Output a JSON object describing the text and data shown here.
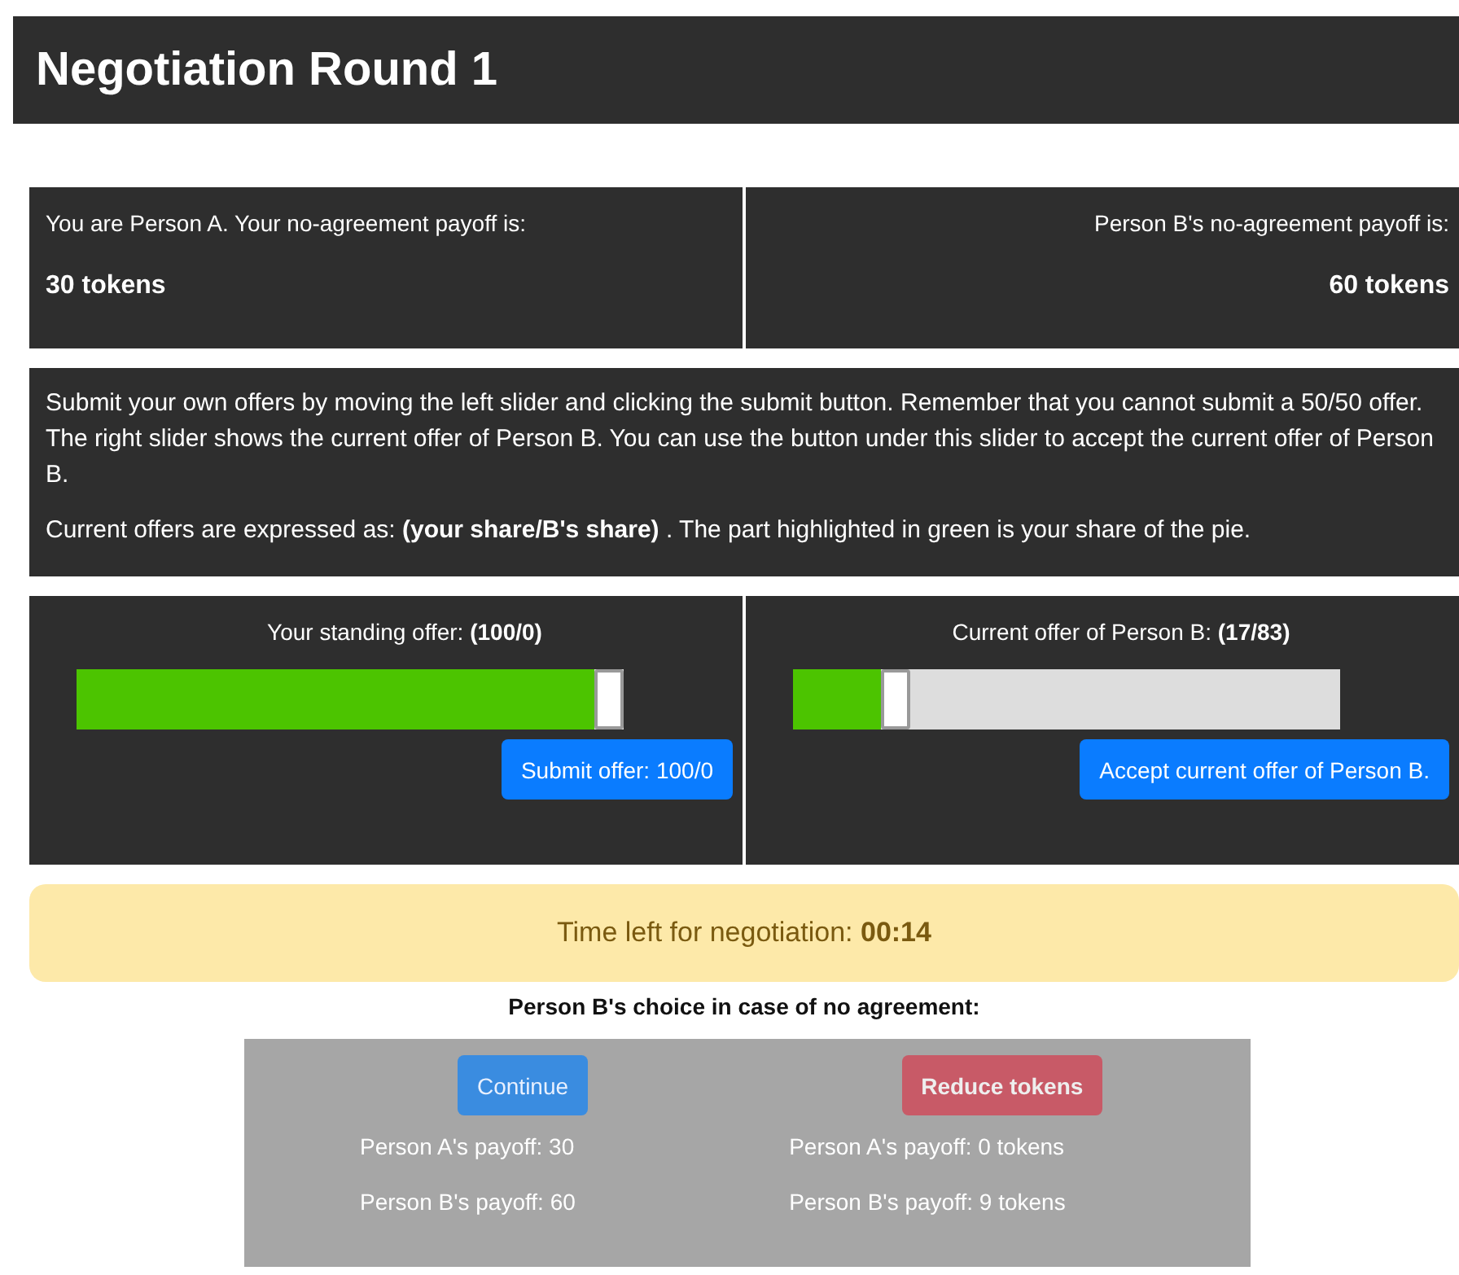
{
  "title": "Negotiation Round 1",
  "payoffs": [
    {
      "label": "You are Person A. Your no-agreement payoff is:",
      "value": "30 tokens"
    },
    {
      "label": "Person B's no-agreement payoff is:",
      "value": "60 tokens"
    }
  ],
  "instructions": [
    "Submit your own offers by moving the left slider and clicking the submit button. Remember that you cannot submit a 50/50 offer. The right slider shows the current offer of Person B. You can use the button under this slider to accept the current offer of Person B.",
    "Current offers are expressed as: **(your share/B's share)** . The part highlighted in green is your share of the pie."
  ],
  "sliders": [
    {
      "label": "Your standing offer: **(100/0)**",
      "level": 1.0,
      "button": "Submit offer: 100/0"
    },
    {
      "label": "Current offer of Person B: **(17/83)**",
      "level": 0.17,
      "button": "Accept current offer of Person B."
    }
  ],
  "timer": {
    "label": "Time left for negotiation:",
    "value": "00:14"
  },
  "choice": {
    "title": "Person B's choice in case of no agreement:",
    "options": [
      {
        "button": "Continue",
        "kind": "primary",
        "lines": [
          "Person A's payoff: 30",
          "Person B's payoff: 60"
        ]
      },
      {
        "button": "Reduce tokens",
        "kind": "danger",
        "lines": [
          "Person A's payoff: 0 tokens",
          "Person B's payoff: 9 tokens"
        ]
      }
    ]
  }
}
